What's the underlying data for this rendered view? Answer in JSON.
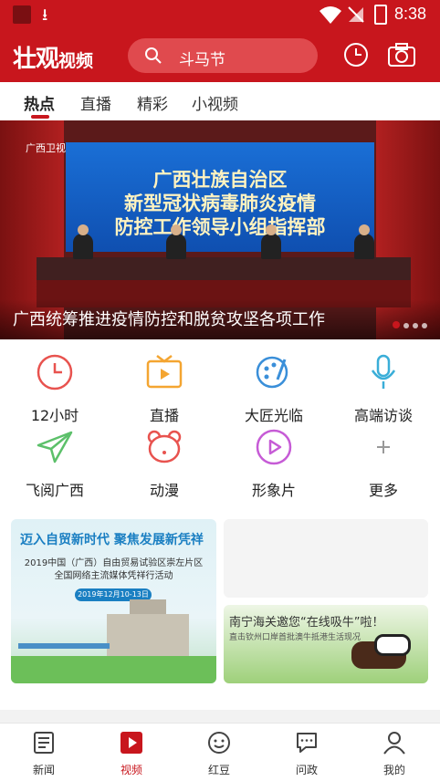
{
  "status_bar": {
    "time": "8:38"
  },
  "app_bar": {
    "logo_main": "壮观",
    "logo_sub": "视频",
    "search_placeholder": "斗马节"
  },
  "tabs": [
    {
      "label": "热点",
      "active": true
    },
    {
      "label": "直播",
      "active": false
    },
    {
      "label": "精彩",
      "active": false
    },
    {
      "label": "小视频",
      "active": false
    }
  ],
  "banner": {
    "tv_logo": "广西卫视",
    "screen_lines": [
      "广西壮族自治区",
      "新型冠状病毒肺炎疫情",
      "防控工作领导小组指挥部"
    ],
    "caption": "广西统筹推进疫情防控和脱贫攻坚各项工作"
  },
  "grid": [
    {
      "label": "12小时",
      "icon": "clock-icon",
      "color": "#e8534f"
    },
    {
      "label": "直播",
      "icon": "tv-icon",
      "color": "#f4a531"
    },
    {
      "label": "大匠光临",
      "icon": "palette-icon",
      "color": "#3a8fd9"
    },
    {
      "label": "高端访谈",
      "icon": "microphone-icon",
      "color": "#3aaed8"
    },
    {
      "label": "飞阅广西",
      "icon": "paper-plane-icon",
      "color": "#5cc06a"
    },
    {
      "label": "动漫",
      "icon": "bear-icon",
      "color": "#e8534f"
    },
    {
      "label": "形象片",
      "icon": "play-circle-icon",
      "color": "#c65bd6"
    },
    {
      "label": "更多",
      "icon": "plus-icon",
      "color": "#999999"
    }
  ],
  "cards": {
    "card1": {
      "headline": "迈入自贸新时代  聚焦发展新凭祥",
      "subline1": "2019中国（广西）自由贸易试验区崇左片区",
      "subline2": "全国网络主流媒体凭祥行活动",
      "date": "2019年12月10-13日"
    },
    "card3": {
      "headline": "南宁海关邀您“在线吸牛”啦！",
      "subline": "直击钦州口岸首批澳牛抵港生活现况"
    }
  },
  "bottom_nav": [
    {
      "label": "新闻",
      "icon": "news-icon",
      "active": false
    },
    {
      "label": "视频",
      "icon": "video-icon",
      "active": true
    },
    {
      "label": "红豆",
      "icon": "smile-icon",
      "active": false
    },
    {
      "label": "问政",
      "icon": "message-icon",
      "active": false
    },
    {
      "label": "我的",
      "icon": "profile-icon",
      "active": false
    }
  ],
  "colors": {
    "brand": "#c8161d",
    "search_bg": "#e04a4e"
  }
}
